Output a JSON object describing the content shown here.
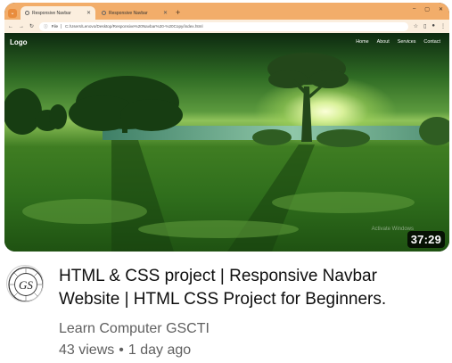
{
  "browser": {
    "tabs": [
      {
        "label": "Responsive Navbar",
        "active": true
      },
      {
        "label": "Responsive Navbar",
        "active": false
      }
    ],
    "new_tab": "+",
    "address_scheme": "File",
    "address": "C:/Users/Lenovo/Desktop/Responsive%20Navbar%20-%20Copy/index.html"
  },
  "site": {
    "logo": "Logo",
    "nav": [
      "Home",
      "About",
      "Services",
      "Contact"
    ],
    "watermark": "Activate Windows"
  },
  "video": {
    "duration": "37:29",
    "title": "HTML & CSS project | Responsive Navbar Website | HTML CSS Project for Beginners.",
    "channel": "Learn Computer GSCTI",
    "views": "43 views",
    "separator": "•",
    "age": "1 day ago"
  },
  "avatar": {
    "initials": "GS",
    "ring_text": "GS COMPUTER TRAINING INSTITUTE"
  },
  "colors": {
    "tabbar": "#f2ad6a",
    "toolbar": "#fbeede",
    "secondary_text": "#606060"
  }
}
